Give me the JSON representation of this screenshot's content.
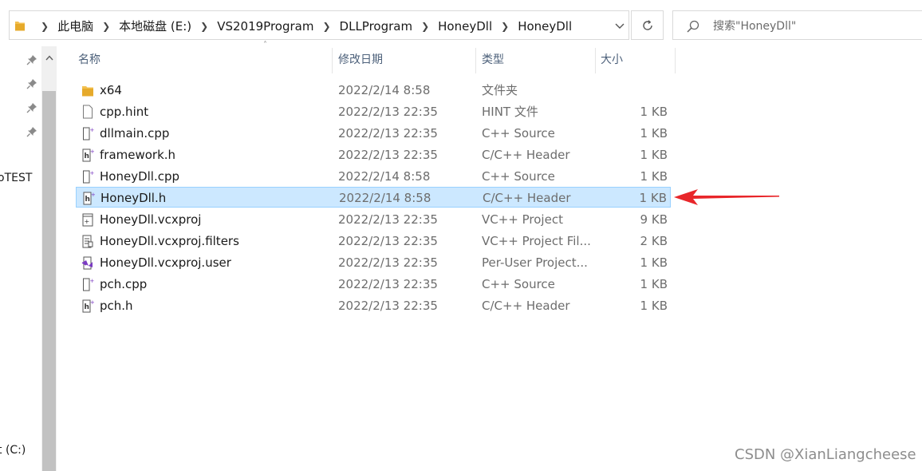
{
  "breadcrumb": [
    "此电脑",
    "本地磁盘 (E:)",
    "VS2019Program",
    "DLLProgram",
    "HoneyDll",
    "HoneyDll"
  ],
  "search": {
    "placeholder": "搜索\"HoneyDll\""
  },
  "nav": {
    "labels": [
      "oTEST",
      "t (C:)"
    ]
  },
  "columns": {
    "name": "名称",
    "date": "修改日期",
    "type": "类型",
    "size": "大小"
  },
  "files": [
    {
      "name": "x64",
      "date": "2022/2/14 8:58",
      "type": "文件夹",
      "size": "",
      "icon": "folder-icon"
    },
    {
      "name": "cpp.hint",
      "date": "2022/2/13 22:35",
      "type": "HINT 文件",
      "size": "1 KB",
      "icon": "file-icon"
    },
    {
      "name": "dllmain.cpp",
      "date": "2022/2/13 22:35",
      "type": "C++ Source",
      "size": "1 KB",
      "icon": "cpp-file-icon"
    },
    {
      "name": "framework.h",
      "date": "2022/2/13 22:35",
      "type": "C/C++ Header",
      "size": "1 KB",
      "icon": "header-file-icon"
    },
    {
      "name": "HoneyDll.cpp",
      "date": "2022/2/14 8:58",
      "type": "C++ Source",
      "size": "1 KB",
      "icon": "cpp-file-icon"
    },
    {
      "name": "HoneyDll.h",
      "date": "2022/2/14 8:58",
      "type": "C/C++ Header",
      "size": "1 KB",
      "icon": "header-file-icon",
      "selected": true
    },
    {
      "name": "HoneyDll.vcxproj",
      "date": "2022/2/13 22:35",
      "type": "VC++ Project",
      "size": "9 KB",
      "icon": "vcxproj-file-icon"
    },
    {
      "name": "HoneyDll.vcxproj.filters",
      "date": "2022/2/13 22:35",
      "type": "VC++ Project Fil...",
      "size": "2 KB",
      "icon": "filters-file-icon"
    },
    {
      "name": "HoneyDll.vcxproj.user",
      "date": "2022/2/13 22:35",
      "type": "Per-User Project...",
      "size": "1 KB",
      "icon": "vs-user-file-icon"
    },
    {
      "name": "pch.cpp",
      "date": "2022/2/13 22:35",
      "type": "C++ Source",
      "size": "1 KB",
      "icon": "cpp-file-icon"
    },
    {
      "name": "pch.h",
      "date": "2022/2/13 22:35",
      "type": "C/C++ Header",
      "size": "1 KB",
      "icon": "header-file-icon"
    }
  ],
  "watermark": "CSDN @XianLiangcheese",
  "colors": {
    "selection_bg": "#cce8ff",
    "selection_border": "#99d1ff",
    "arrow": "#e8262a",
    "folder": "#f3c04f"
  }
}
